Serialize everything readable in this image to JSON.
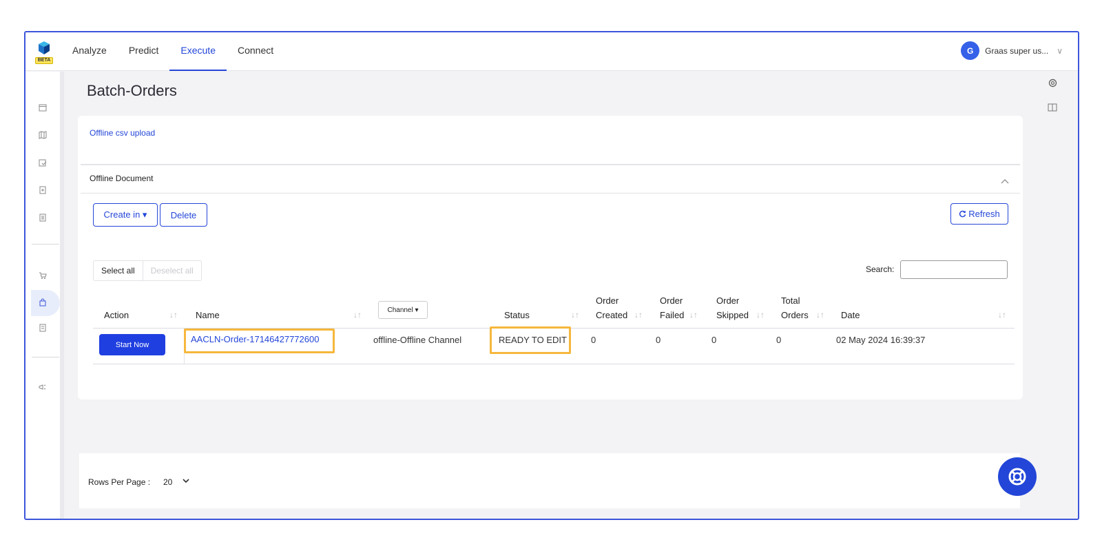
{
  "nav": {
    "beta_badge": "BETA",
    "items": [
      {
        "label": "Analyze",
        "active": false
      },
      {
        "label": "Predict",
        "active": false
      },
      {
        "label": "Execute",
        "active": true
      },
      {
        "label": "Connect",
        "active": false
      }
    ]
  },
  "user": {
    "initial": "G",
    "name": "Graas super us...",
    "chevron": "∨"
  },
  "page": {
    "title": "Batch-Orders"
  },
  "upload": {
    "link": "Offline csv upload"
  },
  "section": {
    "title": "Offline Document"
  },
  "toolbar": {
    "create_in": "Create in ▾",
    "delete": "Delete",
    "refresh": "Refresh",
    "refresh_icon": "refresh-icon"
  },
  "selection": {
    "select_all": "Select all",
    "deselect_all": "Deselect all"
  },
  "search": {
    "label": "Search:",
    "value": ""
  },
  "table": {
    "headers": {
      "action": "Action",
      "name": "Name",
      "channel": "Channel ▾",
      "status": "Status",
      "order_created_1": "Order",
      "order_created_2": "Created",
      "order_failed_1": "Order",
      "order_failed_2": "Failed",
      "order_skipped_1": "Order",
      "order_skipped_2": "Skipped",
      "total_orders_1": "Total",
      "total_orders_2": "Orders",
      "date": "Date"
    },
    "rows": [
      {
        "action": "Start Now",
        "name": "AACLN-Order-17146427772600",
        "channel": "offline-Offline Channel",
        "status": "READY TO EDIT",
        "order_created": "0",
        "order_failed": "0",
        "order_skipped": "0",
        "total_orders": "0",
        "date": "02 May 2024 16:39:37"
      }
    ]
  },
  "pagination": {
    "rows_per_page_label": "Rows Per Page :",
    "rows_per_page": "20"
  },
  "colors": {
    "accent": "#2346d8",
    "highlight": "#f6b73c",
    "frame": "#3b55d9"
  }
}
